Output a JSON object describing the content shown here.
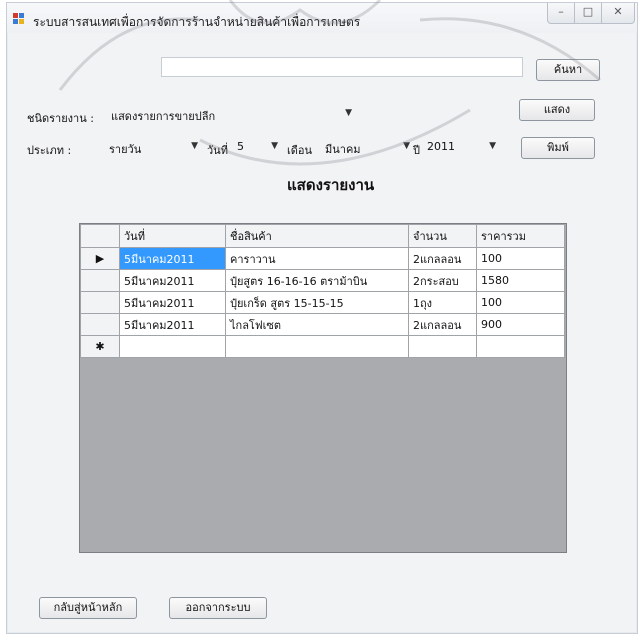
{
  "window": {
    "title": "ระบบสารสนเทศเพื่อการจัดการร้านจำหน่ายสินค้าเพื่อการเกษตร",
    "controls": {
      "minimize": "–",
      "maximize": "□",
      "close": "✕"
    }
  },
  "search": {
    "button_label": "ค้นหา",
    "value": ""
  },
  "report_type": {
    "label": "ชนิดรายงาน :",
    "selected": "แสดงรายการขายปลีก"
  },
  "show_button": "แสดง",
  "filters": {
    "type_label": "ประเภท :",
    "type_value": "รายวัน",
    "day_label": "วันที่",
    "day_value": "5",
    "month_label": "เดือน",
    "month_value": "มีนาคม",
    "year_label": "ปี",
    "year_value": "2011"
  },
  "print_button": "พิมพ์",
  "heading": "แสดงรายงาน",
  "grid": {
    "columns": [
      "วันที่",
      "ชื่อสินค้า",
      "จำนวน",
      "ราคารวม"
    ],
    "rows": [
      [
        "5มีนาคม2011",
        "คาราวาน",
        "2แกลลอน",
        "100"
      ],
      [
        "5มีนาคม2011",
        "ปุ๋ยสูตร 16-16-16 ตราม้าบิน",
        "2กระสอบ",
        "1580"
      ],
      [
        "5มีนาคม2011",
        "ปุ๋ยเกร็ด สูตร 15-15-15",
        "1ถุง",
        "100"
      ],
      [
        "5มีนาคม2011",
        "ไกลโฟเซต",
        "2แกลลอน",
        "900"
      ]
    ],
    "current_row_marker": "▶",
    "new_row_marker": "✱"
  },
  "footer": {
    "back_button": "กลับสู่หน้าหลัก",
    "exit_button": "ออกจากระบบ"
  }
}
